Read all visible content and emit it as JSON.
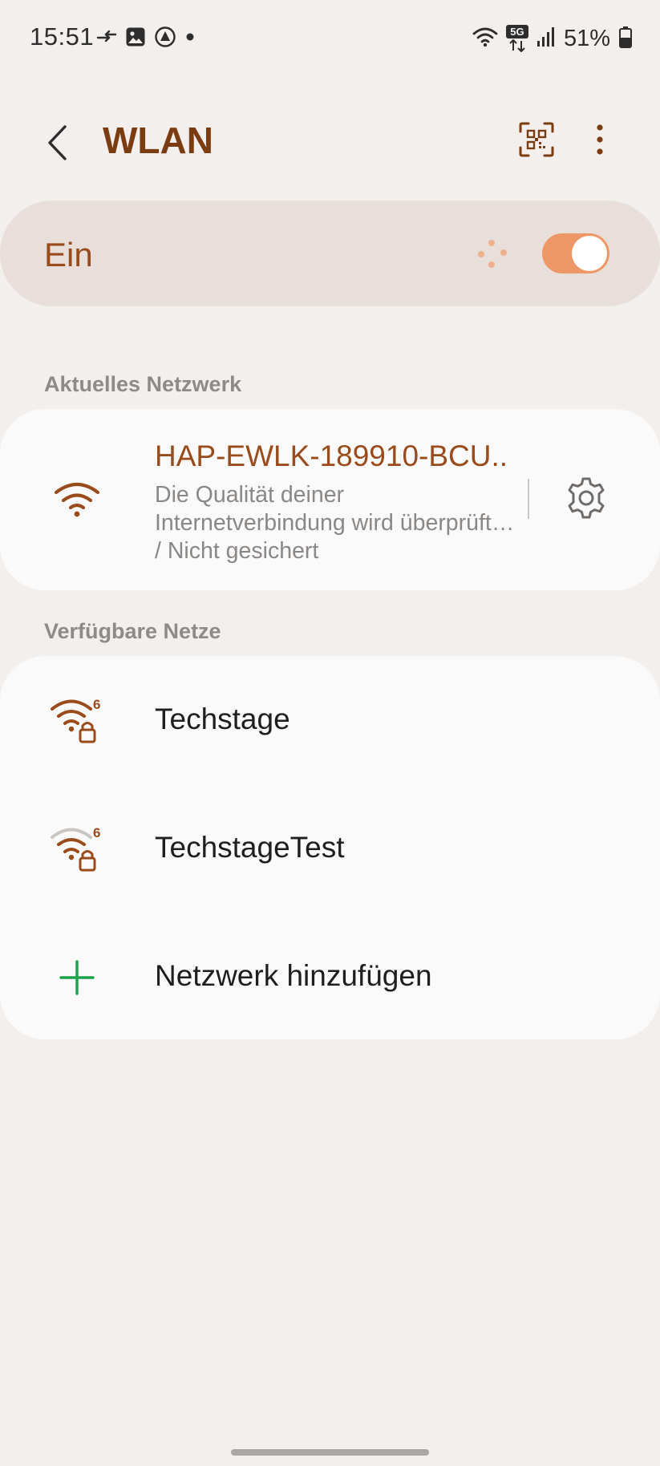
{
  "status_bar": {
    "time": "15:51",
    "battery": "51%",
    "network_badge": "5G",
    "left_icons": [
      "data-transfer-icon",
      "gallery-icon",
      "location-a-icon",
      "dot-icon"
    ],
    "right_icons": [
      "wifi-icon",
      "5g-data-icon",
      "signal-icon",
      "battery-icon"
    ]
  },
  "header": {
    "title": "WLAN",
    "icons": [
      "back-icon",
      "qr-code-icon",
      "more-vertical-icon"
    ]
  },
  "master_toggle": {
    "label": "Ein",
    "state": "on",
    "scanning": true
  },
  "current_network": {
    "section_title": "Aktuelles Netzwerk",
    "name": "HAP-EWLK-189910-BCU..",
    "status": "Die Qualität deiner Internetverbindung wird überprüft… / Nicht gesichert",
    "icon": "wifi-icon",
    "settings_icon": "gear-icon"
  },
  "available_networks": {
    "section_title": "Verfügbare Netze",
    "items": [
      {
        "name": "Techstage",
        "icon": "wifi6-lock-icon",
        "strength": "full"
      },
      {
        "name": "TechstageTest",
        "icon": "wifi6-lock-icon",
        "strength": "medium"
      }
    ],
    "add_network_label": "Netzwerk hinzufügen",
    "add_icon": "plus-icon"
  },
  "colors": {
    "background": "#f3efed",
    "accent": "#9a4b1b",
    "title": "#7b3c12",
    "toggle_on": "#ee9766",
    "master_card": "#e8deda",
    "card": "#fbfafa",
    "secondary_text": "#8a8784",
    "add_icon": "#1aa34a"
  }
}
